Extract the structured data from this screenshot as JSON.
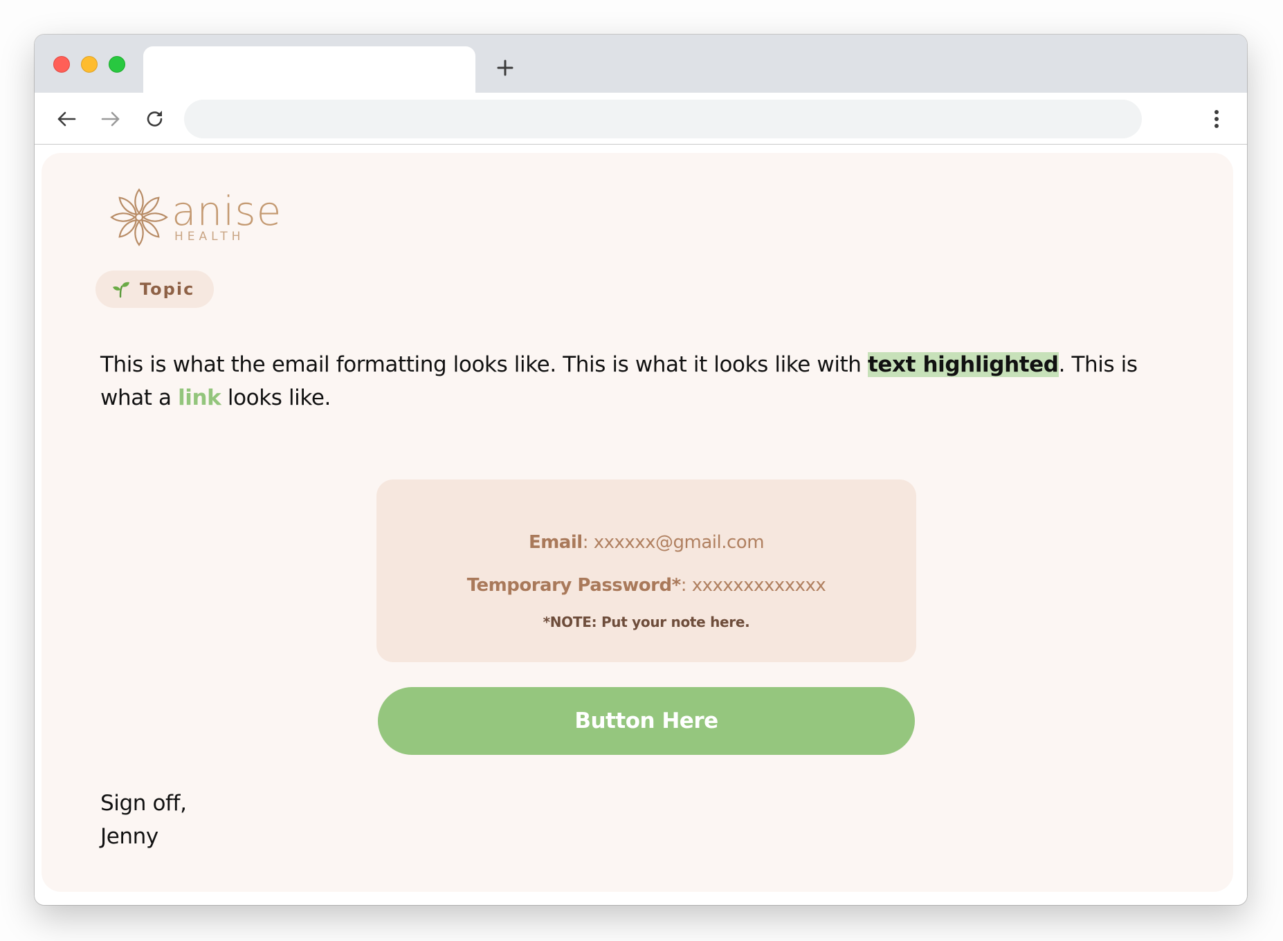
{
  "browser": {
    "tab_title": "",
    "new_tab_icon": "plus-icon",
    "back_icon": "arrow-left-icon",
    "forward_icon": "arrow-right-icon",
    "reload_icon": "reload-icon",
    "menu_icon": "vertical-dots-icon",
    "address": ""
  },
  "email": {
    "brand": {
      "logo_icon": "flower-icon",
      "name": "anise",
      "subtitle": "HEALTH",
      "color": "#c49a72"
    },
    "topic": {
      "icon": "sprout-icon",
      "label": "Topic"
    },
    "body": {
      "text_1": "This is what the email formatting looks like. This is what it looks like with ",
      "highlight": "text highlighted",
      "text_2": ". This is what a ",
      "link": "link",
      "text_3": " looks like."
    },
    "credentials": {
      "email_label": "Email",
      "email_value": ": xxxxxx@gmail.com",
      "password_label": "Temporary Password*",
      "password_value": ": xxxxxxxxxxxxx",
      "note": "*NOTE: Put your note here."
    },
    "button_label": "Button Here",
    "signoff": {
      "line_1": "Sign off,",
      "line_2": "Jenny"
    },
    "colors": {
      "card_background": "#fcf6f3",
      "credentials_background": "#f6e7de",
      "accent_green": "#95c67e",
      "highlight_green": "#c7e1b9",
      "brown_text": "#a9795a"
    }
  }
}
